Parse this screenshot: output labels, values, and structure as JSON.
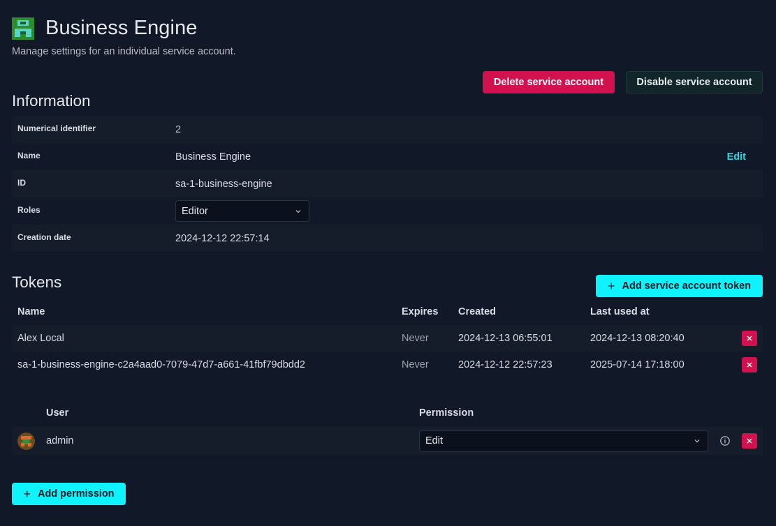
{
  "header": {
    "title": "Business Engine",
    "subtitle": "Manage settings for an individual service account."
  },
  "actions": {
    "delete_label": "Delete service account",
    "disable_label": "Disable service account"
  },
  "information": {
    "section_title": "Information",
    "rows": [
      {
        "label": "Numerical identifier",
        "value": "2"
      },
      {
        "label": "Name",
        "value": "Business Engine",
        "action": "Edit"
      },
      {
        "label": "ID",
        "value": "sa-1-business-engine"
      },
      {
        "label": "Roles",
        "value": "Editor"
      },
      {
        "label": "Creation date",
        "value": "2024-12-12 22:57:14"
      }
    ]
  },
  "tokens": {
    "section_title": "Tokens",
    "add_label": "Add service account token",
    "columns": [
      "Name",
      "Expires",
      "Created",
      "Last used at"
    ],
    "rows": [
      {
        "name": "Alex Local",
        "expires": "Never",
        "created": "2024-12-13 06:55:01",
        "last_used": "2024-12-13 08:20:40"
      },
      {
        "name": "sa-1-business-engine-c2a4aad0-7079-47d7-a661-41fbf79dbdd2",
        "expires": "Never",
        "created": "2024-12-12 22:57:23",
        "last_used": "2025-07-14 17:18:00"
      }
    ]
  },
  "permissions": {
    "columns": [
      "User",
      "Permission"
    ],
    "rows": [
      {
        "user": "admin",
        "permission": "Edit"
      }
    ],
    "add_label": "Add permission"
  },
  "colors": {
    "background": "#111827",
    "danger": "#d1124f",
    "primary": "#0ff3ff",
    "link": "#2ad9e6"
  }
}
